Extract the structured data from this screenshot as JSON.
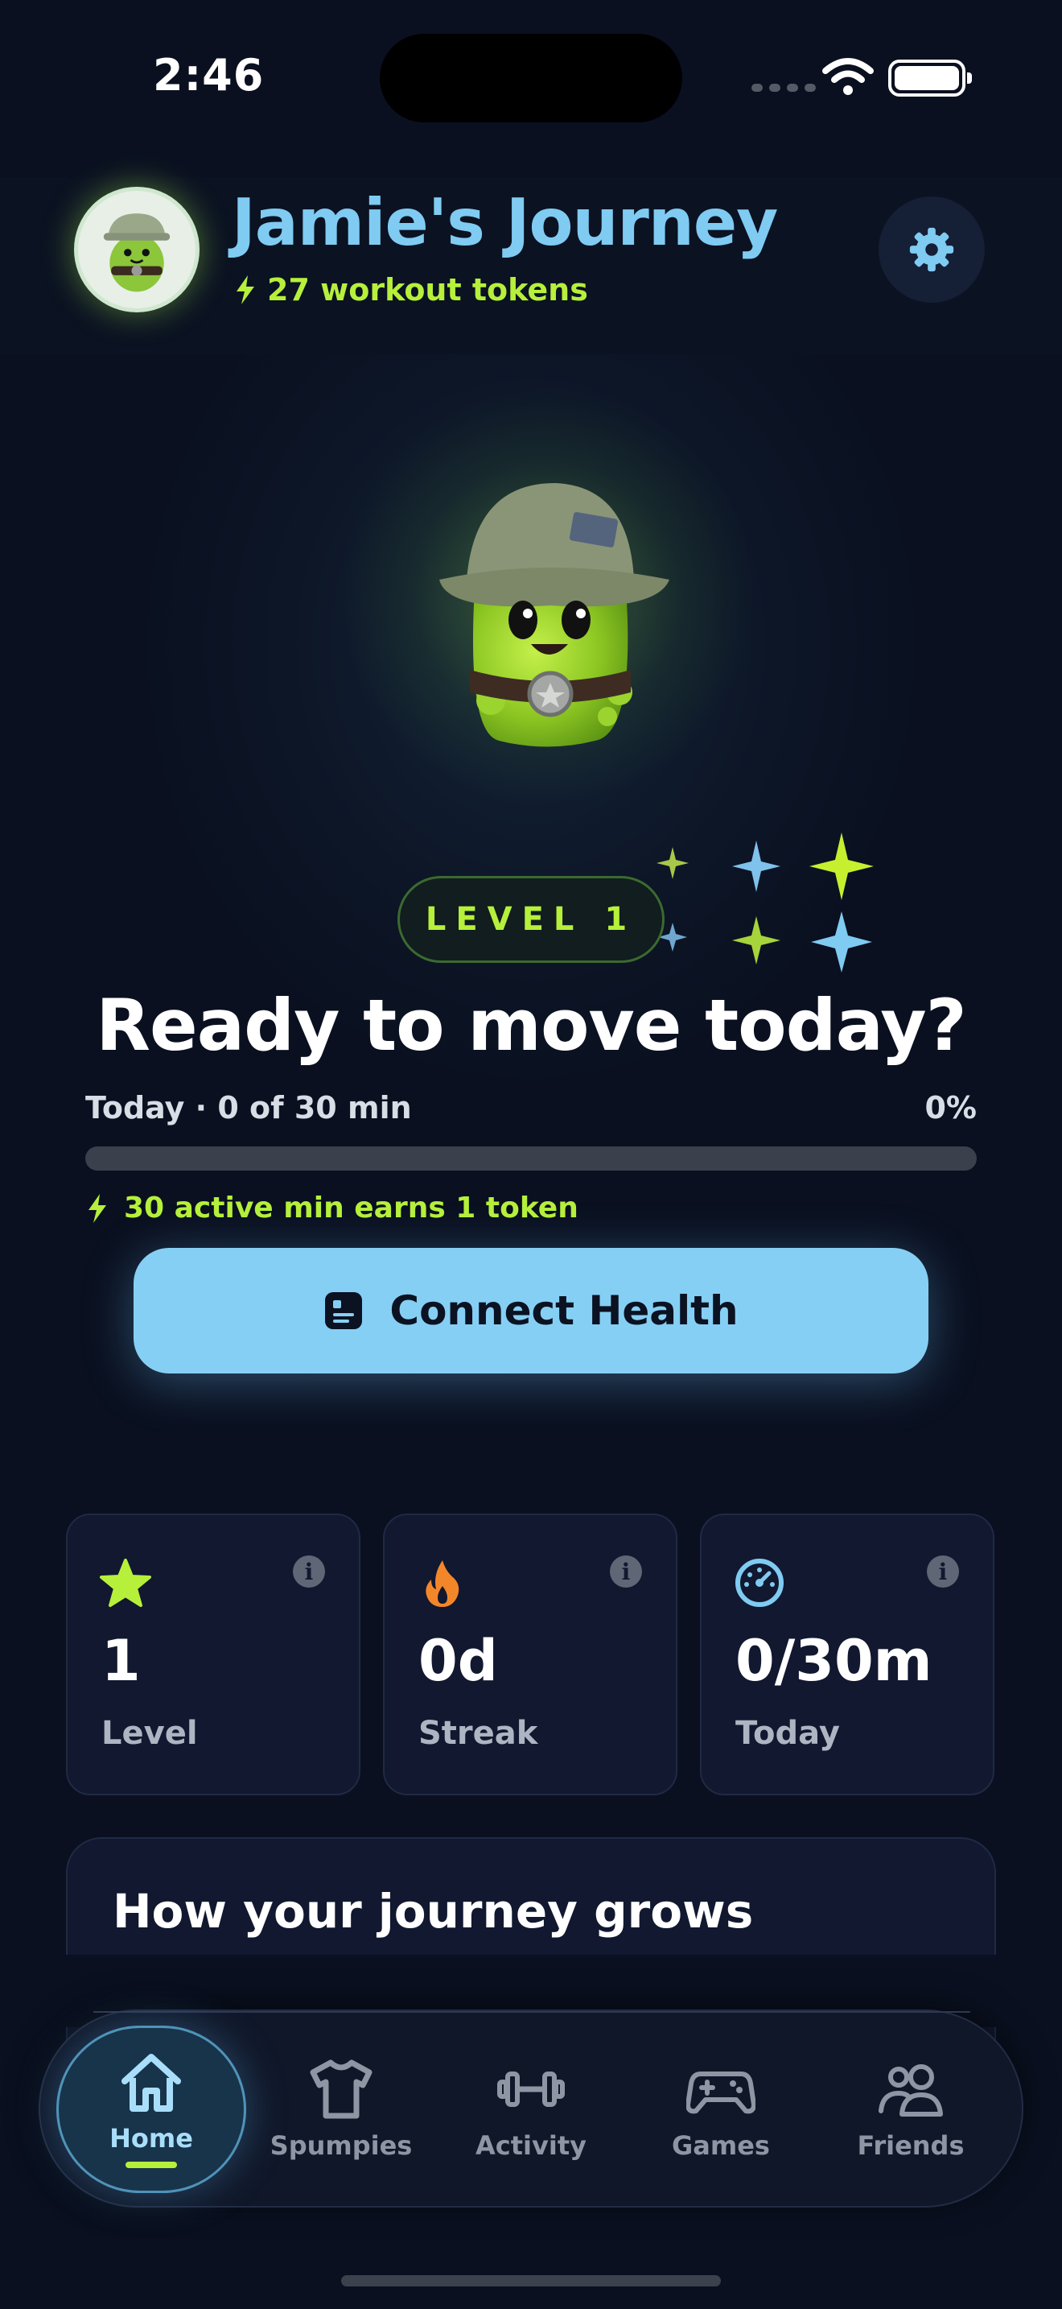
{
  "status_bar": {
    "time": "2:46"
  },
  "header": {
    "title": "Jamie's Journey",
    "tokens_text": "27 workout tokens"
  },
  "hero": {
    "level_badge": "LEVEL 1",
    "headline": "Ready to move today?",
    "progress_label": "Today · 0 of 30 min",
    "progress_percent_text": "0%",
    "progress_fraction": 0,
    "earn_text": "30 active min earns 1 token",
    "connect_button": "Connect Health"
  },
  "stats": [
    {
      "value": "1",
      "label": "Level",
      "icon": "star-icon"
    },
    {
      "value": "0d",
      "label": "Streak",
      "icon": "flame-icon"
    },
    {
      "value": "0/30m",
      "label": "Today",
      "icon": "gauge-icon"
    }
  ],
  "journey_section": {
    "title": "How your journey grows"
  },
  "tabs": [
    {
      "label": "Home",
      "icon": "house-icon",
      "active": true
    },
    {
      "label": "Spumpies",
      "icon": "shirt-icon",
      "active": false
    },
    {
      "label": "Activity",
      "icon": "dumbbell-icon",
      "active": false
    },
    {
      "label": "Games",
      "icon": "gamepad-icon",
      "active": false
    },
    {
      "label": "Friends",
      "icon": "people-icon",
      "active": false
    }
  ],
  "colors": {
    "background": "#0a1020",
    "title_blue": "#7fcbf2",
    "accent_lime": "#b6f03b",
    "button_blue": "#86cff4",
    "card_bg": "#111830"
  }
}
